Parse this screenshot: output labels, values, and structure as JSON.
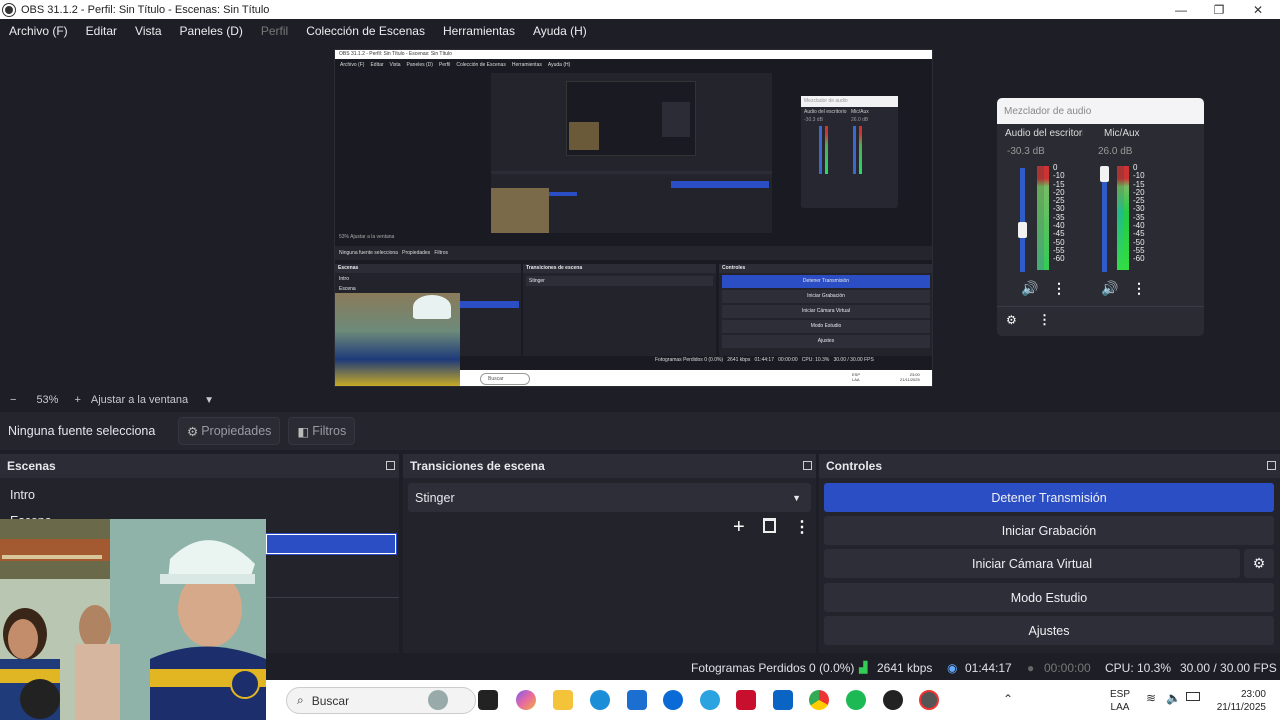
{
  "window": {
    "title": "OBS 31.1.2 - Perfil: Sin Título - Escenas: Sin Título"
  },
  "menu": [
    "Archivo (F)",
    "Editar",
    "Vista",
    "Paneles (D)",
    "Perfil",
    "Colección de Escenas",
    "Herramientas",
    "Ayuda (H)"
  ],
  "zoom": {
    "minus": "−",
    "level": "53%",
    "plus": "+",
    "fit": "Ajustar a la ventana"
  },
  "source_bar": {
    "none_selected": "Ninguna fuente selecciona",
    "properties": "Propiedades",
    "filters": "Filtros"
  },
  "scenes": {
    "title": "Escenas",
    "items": [
      "Intro",
      "Escena"
    ]
  },
  "transitions": {
    "title": "Transiciones de escena",
    "selected": "Stinger"
  },
  "controls": {
    "title": "Controles",
    "stop_stream": "Detener Transmisión",
    "start_recording": "Iniciar Grabación",
    "start_virtual_cam": "Iniciar Cámara Virtual",
    "studio_mode": "Modo Estudio",
    "settings": "Ajustes"
  },
  "mixer": {
    "title": "Mezclador de audio",
    "channels": [
      {
        "name": "Audio del escritorio",
        "db": "-30.3 dB"
      },
      {
        "name": "Mic/Aux",
        "db": "26.0 dB"
      }
    ],
    "scale": [
      "0",
      "-10",
      "-15",
      "-20",
      "-25",
      "-30",
      "-35",
      "-40",
      "-45",
      "-50",
      "-55",
      "-60"
    ]
  },
  "status": {
    "dropped": "Fotogramas Perdidos 0 (0.0%)",
    "bitrate": "2641 kbps",
    "stream_time": "01:44:17",
    "rec_time": "00:00:00",
    "cpu": "CPU: 10.3%",
    "fps": "30.00 / 30.00 FPS"
  },
  "taskbar": {
    "search": "Buscar",
    "lang": "ESP",
    "layout": "LAA",
    "time": "23:00",
    "date": "21/11/2025"
  },
  "nested": {
    "title": "OBS 31.1.2 - Perfil: Sin Título - Escenas: Sin Título",
    "menu": [
      "Archivo (F)",
      "Editar",
      "Vista",
      "Paneles (D)",
      "Perfil",
      "Colección de Escenas",
      "Herramientas",
      "Ayuda (H)"
    ],
    "zoom": "53%",
    "fit": "Ajustar a la ventana",
    "none_selected": "Ninguna fuente selecciona",
    "properties": "Propiedades",
    "filters": "Filtros",
    "scenes": "Escenas",
    "intro": "Intro",
    "escena": "Escena",
    "transitions": "Transiciones de escena",
    "stinger": "Stinger",
    "controls": "Controles",
    "stop": "Detener Transmisión",
    "rec": "Iniciar Grabación",
    "vcam": "Iniciar Cámara Virtual",
    "studio": "Modo Estudio",
    "settings": "Ajustes",
    "status": "Fotogramas Perdidos 0 (0.0%)",
    "bitrate": "2641 kbps",
    "stream_time": "01:44:17",
    "rec_time": "00:00:00",
    "cpu": "CPU: 10.3%",
    "fps": "30.00 / 30.00 FPS",
    "mixer_title": "Mezclador de audio",
    "desk": "Audio del escritorio",
    "mic": "Mic/Aux",
    "desk_db": "-30.3 dB",
    "mic_db": "26.0 dB",
    "search": "Buscar",
    "lang": "ESP",
    "layout": "LAA",
    "time": "23:00",
    "date": "21/11/2025"
  }
}
